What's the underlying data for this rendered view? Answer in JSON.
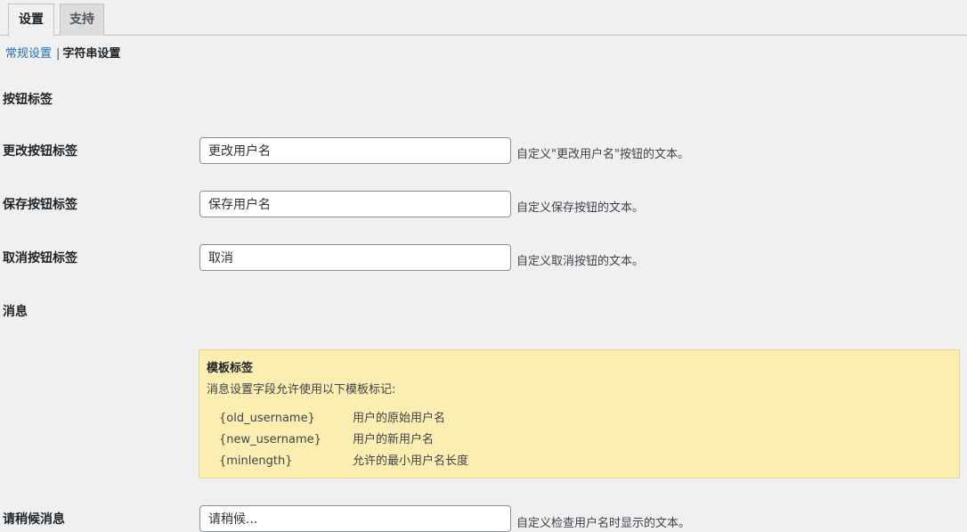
{
  "tabs": [
    {
      "label": "设置",
      "active": true
    },
    {
      "label": "支持",
      "active": false
    }
  ],
  "subnav": {
    "general": "常规设置",
    "separator": "|",
    "strings": "字符串设置"
  },
  "sections": {
    "button_labels": "按钮标签",
    "messages": "消息"
  },
  "fields": {
    "change": {
      "label": "更改按钮标签",
      "value": "更改用户名",
      "desc": "自定义\"更改用户名\"按钮的文本。"
    },
    "save": {
      "label": "保存按钮标签",
      "value": "保存用户名",
      "desc": "自定义保存按钮的文本。"
    },
    "cancel": {
      "label": "取消按钮标签",
      "value": "取消",
      "desc": "自定义取消按钮的文本。"
    },
    "wait": {
      "label": "请稍候消息",
      "value": "请稍候...",
      "desc": "自定义检查用户名时显示的文本。"
    }
  },
  "template_notice": {
    "title": "模板标签",
    "intro": "消息设置字段允许使用以下模板标记:",
    "tags": [
      {
        "tag": "{old_username}",
        "desc": "用户的原始用户名"
      },
      {
        "tag": "{new_username}",
        "desc": "用户的新用户名"
      },
      {
        "tag": "{minlength}",
        "desc": "允许的最小用户名长度"
      }
    ]
  },
  "colors": {
    "link": "#2271b1",
    "notice_bg": "#fcedb0",
    "page_bg": "#f0f0f1"
  }
}
